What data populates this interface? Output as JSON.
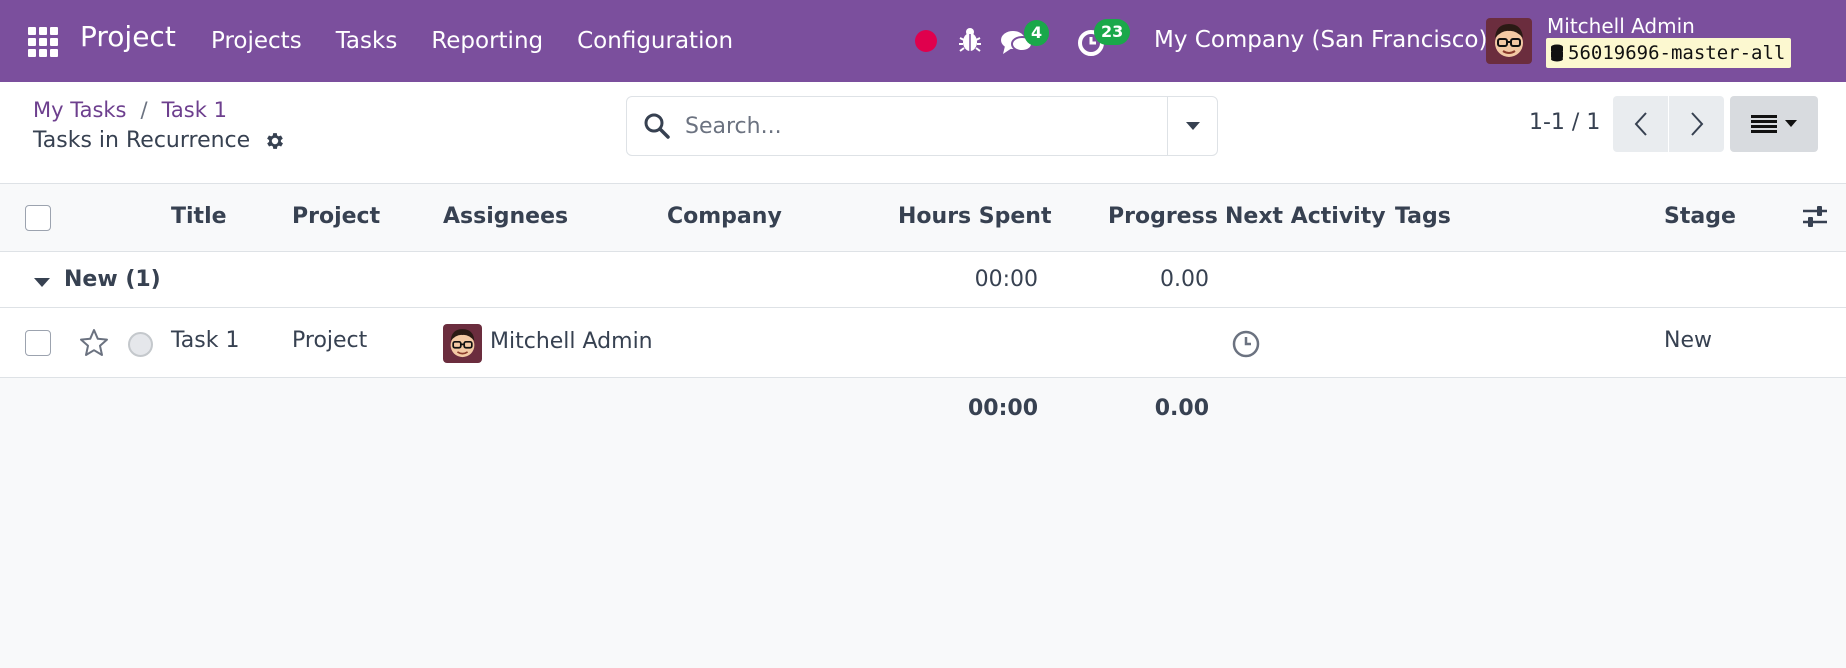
{
  "navbar": {
    "app_title": "Project",
    "menu": [
      "Projects",
      "Tasks",
      "Reporting",
      "Configuration"
    ],
    "messages_count": "4",
    "activities_count": "23",
    "company": "My Company (San Francisco)",
    "user_name": "Mitchell Admin",
    "db_name": "56019696-master-all",
    "colors": {
      "bar": "#7b4f9d",
      "badge": "#1aa84a",
      "rec": "#e0004d"
    }
  },
  "control": {
    "breadcrumb": [
      "My Tasks",
      "Task 1"
    ],
    "breadcrumb_sep": "/",
    "title": "Tasks in Recurrence",
    "search_placeholder": "Search...",
    "pager": "1-1 / 1"
  },
  "table": {
    "columns": [
      "Title",
      "Project",
      "Assignees",
      "Company",
      "Hours Spent",
      "Progress",
      "Next Activity",
      "Tags",
      "Stage"
    ],
    "group": {
      "label": "New (1)",
      "hours": "00:00",
      "progress": "0.00"
    },
    "rows": [
      {
        "title": "Task 1",
        "project": "Project",
        "assignee": "Mitchell Admin",
        "stage": "New"
      }
    ],
    "totals": {
      "hours": "00:00",
      "progress": "0.00"
    }
  }
}
